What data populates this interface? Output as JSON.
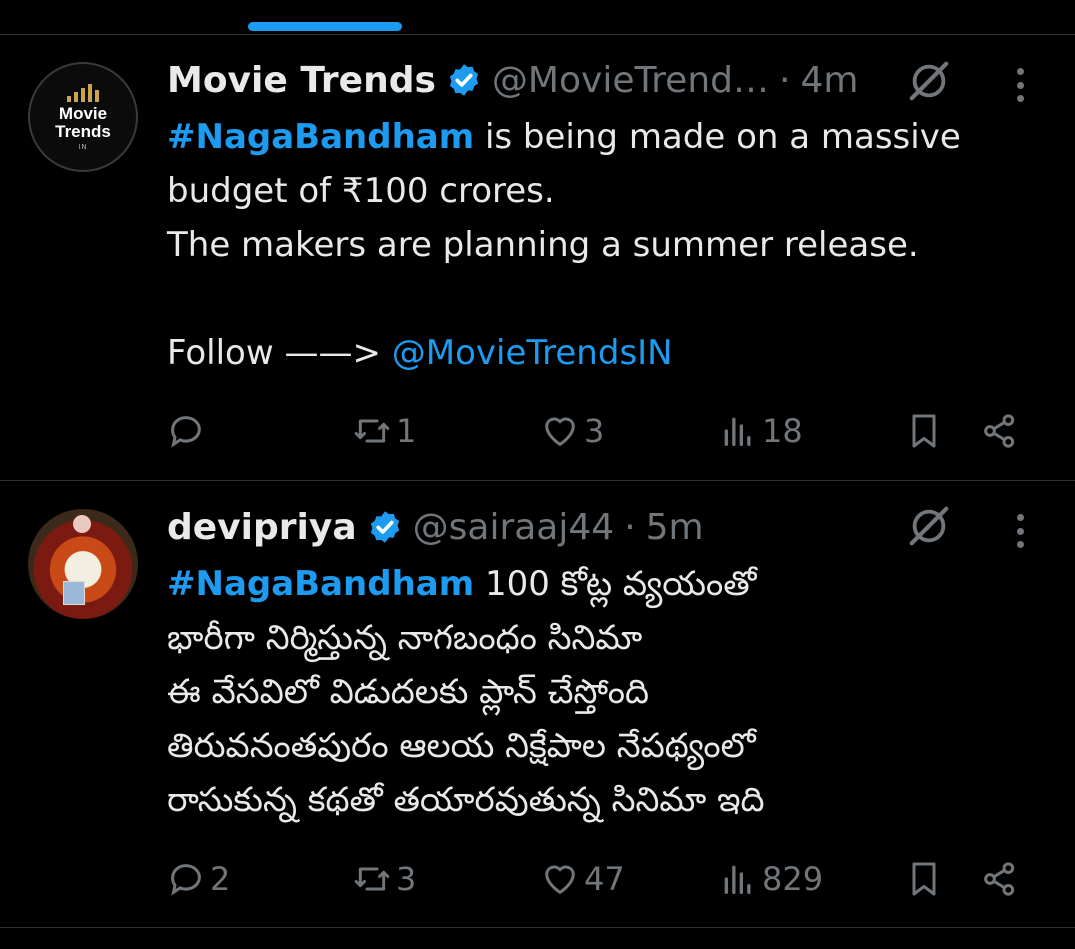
{
  "tweets": [
    {
      "name": "Movie Trends",
      "handle": "@MovieTrend…",
      "separator": "·",
      "time": "4m",
      "avatar_text": [
        "Movie",
        "Trends",
        "IN"
      ],
      "text_parts": {
        "hashtag": "#NagaBandham",
        "line1_rest": " is being made on a massive",
        "line2": "budget of ₹100 crores.",
        "line3": "The makers are planning a summer release.",
        "follow": "Follow ——> ",
        "mention": "@MovieTrendsIN"
      },
      "stats": {
        "replies": "",
        "reposts": "1",
        "likes": "3",
        "views": "18"
      }
    },
    {
      "name": "devipriya",
      "handle": "@sairaaj44",
      "separator": "·",
      "time": "5m",
      "text_parts": {
        "hashtag": "#NagaBandham",
        "line1_rest": " 100 కోట్ల వ్యయంతో",
        "line2": "భారీగా నిర్మిస్తున్న నాగబంధం సినిమా",
        "line3": "ఈ వేసవిలో విడుదలకు ప్లాన్ చేస్తోంది",
        "line4": "తిరువనంతపురం ఆలయ నిక్షేపాల నేపథ్యంలో",
        "line5": "రాసుకున్న కథతో తయారవుతున్న సినిమా ఇది"
      },
      "stats": {
        "replies": "2",
        "reposts": "3",
        "likes": "47",
        "views": "829"
      }
    }
  ],
  "icons": [
    "verified-badge-icon",
    "grok-icon",
    "more-icon",
    "reply-icon",
    "repost-icon",
    "like-icon",
    "views-icon",
    "bookmark-icon",
    "share-icon"
  ],
  "colors": {
    "background": "#000000",
    "text": "#e7e9ea",
    "muted": "#71767b",
    "accent": "#1d9bf0",
    "divider": "#2f3336"
  }
}
